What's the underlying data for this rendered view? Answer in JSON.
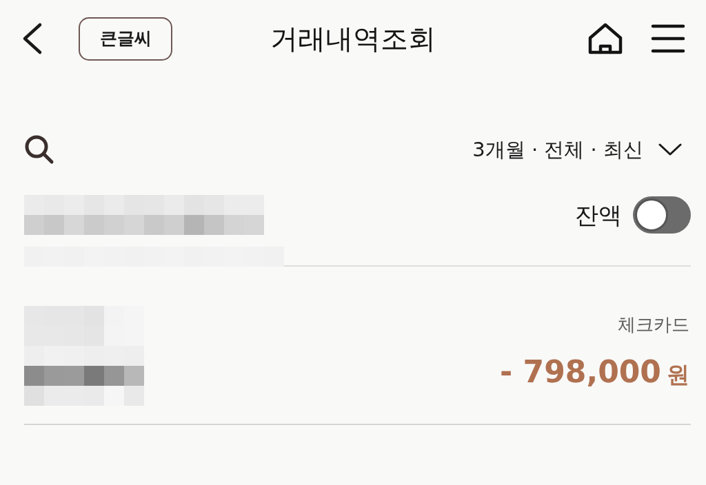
{
  "header": {
    "title": "거래내역조회",
    "large_text_button": "큰글씨"
  },
  "filter": {
    "label": "3개월 · 전체 · 최신"
  },
  "balance_toggle": {
    "label": "잔액",
    "on": false
  },
  "transactions": [
    {
      "type": "체크카드",
      "amount": "- 798,000",
      "currency": "원"
    }
  ]
}
